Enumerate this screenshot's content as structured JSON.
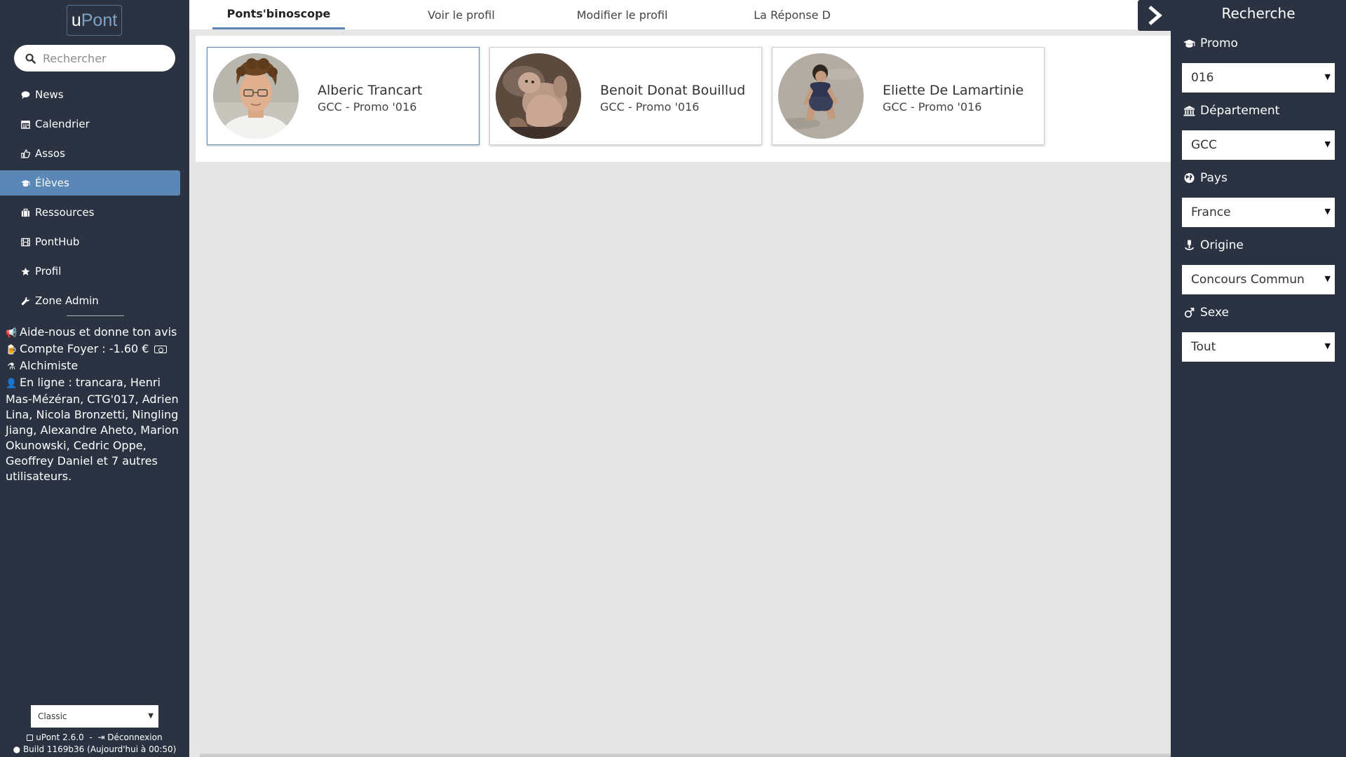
{
  "app": {
    "logo_part1": "u",
    "logo_part2": "Pont",
    "search_placeholder": "Rechercher"
  },
  "sidebar": {
    "items": [
      {
        "label": "News",
        "icon": "comment-icon",
        "active": false
      },
      {
        "label": "Calendrier",
        "icon": "calendar-icon",
        "active": false
      },
      {
        "label": "Assos",
        "icon": "thumbs-up-icon",
        "active": false
      },
      {
        "label": "Élèves",
        "icon": "graduation-cap-icon",
        "active": true
      },
      {
        "label": "Ressources",
        "icon": "briefcase-icon",
        "active": false
      },
      {
        "label": "PontHub",
        "icon": "film-icon",
        "active": false
      },
      {
        "label": "Profil",
        "icon": "star-icon",
        "active": false
      },
      {
        "label": "Zone Admin",
        "icon": "wrench-icon",
        "active": false
      }
    ],
    "info": {
      "feedback": "Aide-nous et donne ton avis",
      "foyer": "Compte Foyer : -1.60 €",
      "achievement": "Alchimiste",
      "online": "En ligne : trancara, Henri Mas-Mézéran, CTG'017, Adrien Lina, Nicola Bronzetti, Ningling Jiang, Alexandre Aheto, Marion Okunowski, Cedric Oppe, Geoffrey Daniel et 7 autres utilisateurs."
    },
    "theme_select": "Classic",
    "footer": {
      "version": "uPont 2.6.0",
      "separator": "-",
      "logout": "Déconnexion",
      "build": "Build 1169b36",
      "build_time": "(Aujourd'hui à 00:50)"
    }
  },
  "tabs": [
    {
      "label": "Ponts'binoscope",
      "active": true
    },
    {
      "label": "Voir le profil",
      "active": false
    },
    {
      "label": "Modifier le profil",
      "active": false
    },
    {
      "label": "La Réponse D",
      "active": false
    }
  ],
  "results": [
    {
      "name": "Alberic Trancart",
      "subtitle": "GCC - Promo '016",
      "selected": true
    },
    {
      "name": "Benoit Donat Bouillud",
      "subtitle": "GCC - Promo '016",
      "selected": false
    },
    {
      "name": "Eliette De Lamartinie",
      "subtitle": "GCC - Promo '016",
      "selected": false
    }
  ],
  "search_panel": {
    "title": "Recherche",
    "filters": [
      {
        "label": "Promo",
        "icon": "graduation-cap-icon",
        "value": "016"
      },
      {
        "label": "Département",
        "icon": "bank-icon",
        "value": "GCC"
      },
      {
        "label": "Pays",
        "icon": "globe-icon",
        "value": "France"
      },
      {
        "label": "Origine",
        "icon": "anchor-icon",
        "value": "Concours Commun"
      },
      {
        "label": "Sexe",
        "icon": "gender-icon",
        "value": "Tout"
      }
    ]
  },
  "colors": {
    "sidebar_bg": "#2b3343",
    "accent": "#5b87b6",
    "content_bg": "#e6e6e6"
  }
}
